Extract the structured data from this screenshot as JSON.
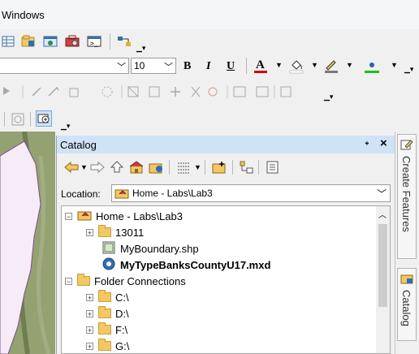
{
  "menu": {
    "windows": "Windows"
  },
  "font_toolbar": {
    "size_value": "10",
    "bold": "B",
    "italic": "I",
    "underline": "U",
    "font_color_letter": "A"
  },
  "catalog": {
    "title": "Catalog",
    "pin": "↕",
    "close": "×",
    "location_label": "Location:",
    "location_value": "Home - Labs\\Lab3"
  },
  "tree": {
    "items": [
      {
        "label": "Home - Labs\\Lab3",
        "expander": "−",
        "icon": "home-folder"
      },
      {
        "label": "13011",
        "expander": "+",
        "icon": "folder"
      },
      {
        "label": "MyBoundary.shp",
        "expander": "",
        "icon": "shapefile"
      },
      {
        "label": "MyTypeBanksCountyU17.mxd",
        "expander": "",
        "icon": "map-document"
      },
      {
        "label": "Folder Connections",
        "expander": "−",
        "icon": "folder-connections"
      },
      {
        "label": "C:\\",
        "expander": "+",
        "icon": "drive-folder"
      },
      {
        "label": "D:\\",
        "expander": "+",
        "icon": "drive-folder"
      },
      {
        "label": "F:\\",
        "expander": "+",
        "icon": "drive-folder"
      },
      {
        "label": "G:\\",
        "expander": "+",
        "icon": "drive-folder"
      }
    ]
  },
  "side_tabs": {
    "create_features": "Create Features",
    "catalog": "Catalog"
  },
  "colors": {
    "title_bar": "#cfe3f7",
    "map_green": "#8f9c6e",
    "boundary_fill": "#f6ecf7",
    "font_color_red": "#d40000",
    "line_color_green": "#18c418"
  }
}
